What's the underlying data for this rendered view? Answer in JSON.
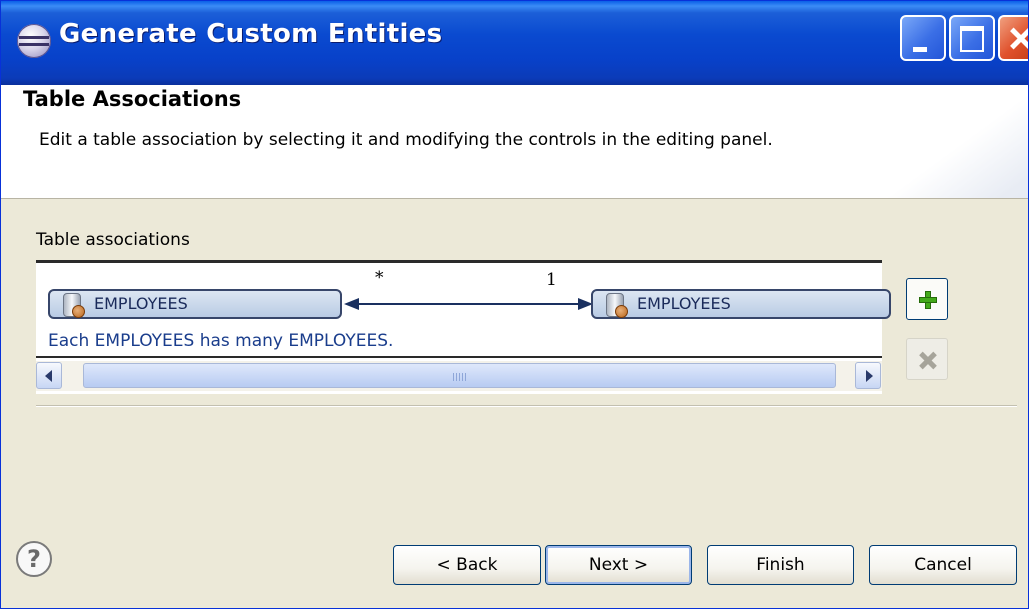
{
  "window": {
    "title": "Generate Custom Entities",
    "icon": "eclipse-icon"
  },
  "header": {
    "title": "Table Associations",
    "description": "Edit a table association by selecting it and modifying the controls in the editing panel."
  },
  "associations": {
    "label": "Table associations",
    "items": [
      {
        "source_table": "EMPLOYEES",
        "target_table": "EMPLOYEES",
        "source_multiplicity": "*",
        "target_multiplicity": "1",
        "description": "Each EMPLOYEES has many EMPLOYEES."
      }
    ],
    "scrollbar_grip": "III"
  },
  "side_buttons": {
    "add": "plus-icon",
    "remove": "delete-x-icon"
  },
  "footer": {
    "help": "?",
    "back": "< Back",
    "next": "Next >",
    "finish": "Finish",
    "cancel": "Cancel"
  },
  "colors": {
    "titlebar": "#0a4ad0",
    "dialog_bg": "#ece9d8",
    "link_text": "#1a3d8c",
    "table_box": "#b9cbe4"
  }
}
